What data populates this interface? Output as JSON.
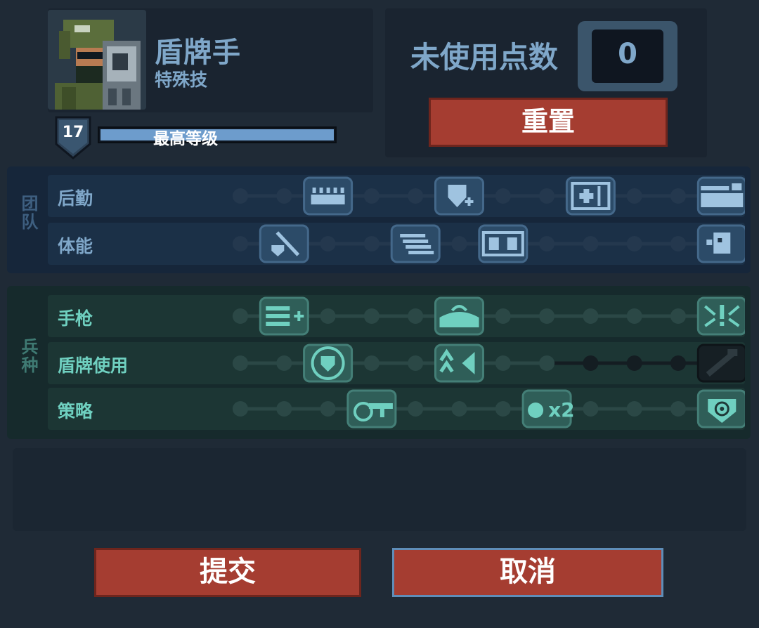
{
  "hero": {
    "name": "盾牌手",
    "class_label": "特殊技",
    "level": "17",
    "xp_label": "最高等级",
    "xp_progress": 1.0,
    "portrait_icon": "shield-soldier-portrait-icon"
  },
  "points": {
    "label": "未使用点数",
    "value": "0",
    "reset_label": "重置"
  },
  "sections": [
    {
      "label": "团队",
      "color": "#7fa7c9",
      "rows": [
        {
          "label": "后勤",
          "slots": [
            "node",
            "node",
            "icon:ammo-belt-icon",
            "node",
            "node",
            "icon:shield-plus-icon",
            "node",
            "node",
            "icon:medkit-icon",
            "node",
            "node",
            "icon:crate-icon"
          ]
        },
        {
          "label": "体能",
          "slots": [
            "node",
            "icon:knife-shield-icon",
            "node",
            "node",
            "icon:dash-icon",
            "node",
            "icon:grid-armor-icon",
            "node",
            "node",
            "node",
            "node",
            "icon:face-icon"
          ]
        }
      ]
    },
    {
      "label": "兵种",
      "color": "#6fd0c0",
      "rows": [
        {
          "label": "手枪",
          "slots": [
            "node",
            "icon:pistol-ammo-icon",
            "node",
            "node",
            "node",
            "icon:arc-icon",
            "node",
            "node",
            "node",
            "node",
            "node",
            "icon:burst-icon"
          ]
        },
        {
          "label": "盾牌使用",
          "slots": [
            "node",
            "node",
            "icon:round-shield-icon",
            "node",
            "node",
            "icon:chevron-shield-icon",
            "node",
            "node",
            "locked",
            "locked",
            "locked",
            "locked-icon:wrench-icon"
          ]
        },
        {
          "label": "策略",
          "slots": [
            "node",
            "node",
            "node",
            "icon:grenade-gun-icon",
            "node",
            "node",
            "node",
            "icon:grenade-x2-icon",
            "node",
            "node",
            "node",
            "icon:target-icon"
          ]
        }
      ]
    }
  ],
  "buttons": {
    "submit": "提交",
    "cancel": "取消"
  },
  "icon_text": {
    "grenade_x2": "x2"
  },
  "colors": {
    "background": "#1f2a36",
    "team_accent": "#7fa7c9",
    "class_accent": "#6fd0c0",
    "button_red": "#a53d31"
  }
}
